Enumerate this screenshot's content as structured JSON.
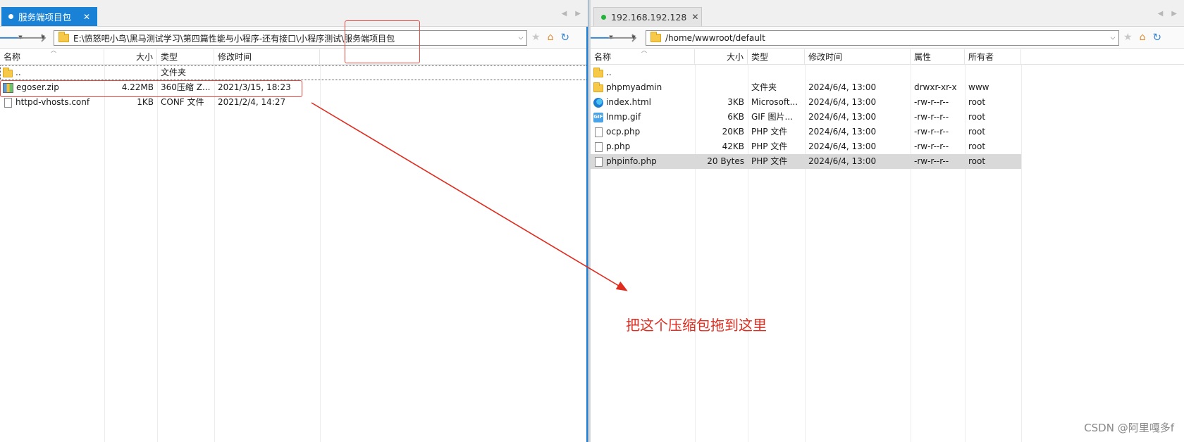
{
  "left": {
    "tab": {
      "label": "服务端项目包"
    },
    "address": "E:\\愤怒吧小鸟\\黑马测试学习\\第四篇性能与小程序-还有接口\\小程序测试\\服务端项目包",
    "columns": {
      "name": "名称",
      "size": "大小",
      "type": "类型",
      "modified": "修改时间"
    },
    "rows": [
      {
        "name": "..",
        "icon": "folder-icon",
        "size": "",
        "type": "文件夹",
        "modified": ""
      },
      {
        "name": "egoser.zip",
        "icon": "zip-icon",
        "size": "4.22MB",
        "type": "360压缩 Z...",
        "modified": "2021/3/15, 18:23"
      },
      {
        "name": "httpd-vhosts.conf",
        "icon": "file-icon",
        "size": "1KB",
        "type": "CONF 文件",
        "modified": "2021/2/4, 14:27"
      }
    ]
  },
  "right": {
    "tab": {
      "label": "192.168.192.128"
    },
    "address": "/home/wwwroot/default",
    "columns": {
      "name": "名称",
      "size": "大小",
      "type": "类型",
      "modified": "修改时间",
      "perms": "属性",
      "owner": "所有者"
    },
    "rows": [
      {
        "name": "..",
        "icon": "folder-icon",
        "size": "",
        "type": "",
        "modified": "",
        "perms": "",
        "owner": ""
      },
      {
        "name": "phpmyadmin",
        "icon": "folder-icon",
        "size": "",
        "type": "文件夹",
        "modified": "2024/6/4, 13:00",
        "perms": "drwxr-xr-x",
        "owner": "www"
      },
      {
        "name": "index.html",
        "icon": "edge-icon",
        "size": "3KB",
        "type": "Microsoft...",
        "modified": "2024/6/4, 13:00",
        "perms": "-rw-r--r--",
        "owner": "root"
      },
      {
        "name": "lnmp.gif",
        "icon": "gif-icon",
        "size": "6KB",
        "type": "GIF 图片...",
        "modified": "2024/6/4, 13:00",
        "perms": "-rw-r--r--",
        "owner": "root"
      },
      {
        "name": "ocp.php",
        "icon": "file-icon",
        "size": "20KB",
        "type": "PHP 文件",
        "modified": "2024/6/4, 13:00",
        "perms": "-rw-r--r--",
        "owner": "root"
      },
      {
        "name": "p.php",
        "icon": "file-icon",
        "size": "42KB",
        "type": "PHP 文件",
        "modified": "2024/6/4, 13:00",
        "perms": "-rw-r--r--",
        "owner": "root"
      },
      {
        "name": "phpinfo.php",
        "icon": "file-icon",
        "size": "20 Bytes",
        "type": "PHP 文件",
        "modified": "2024/6/4, 13:00",
        "perms": "-rw-r--r--",
        "owner": "root"
      }
    ]
  },
  "annotation": {
    "text": "把这个压缩包拖到这里"
  },
  "watermark": "CSDN @阿里嘎多f",
  "colors": {
    "accent": "#1a82d6",
    "annotation": "#e02b1f",
    "connected": "#22b33a"
  }
}
